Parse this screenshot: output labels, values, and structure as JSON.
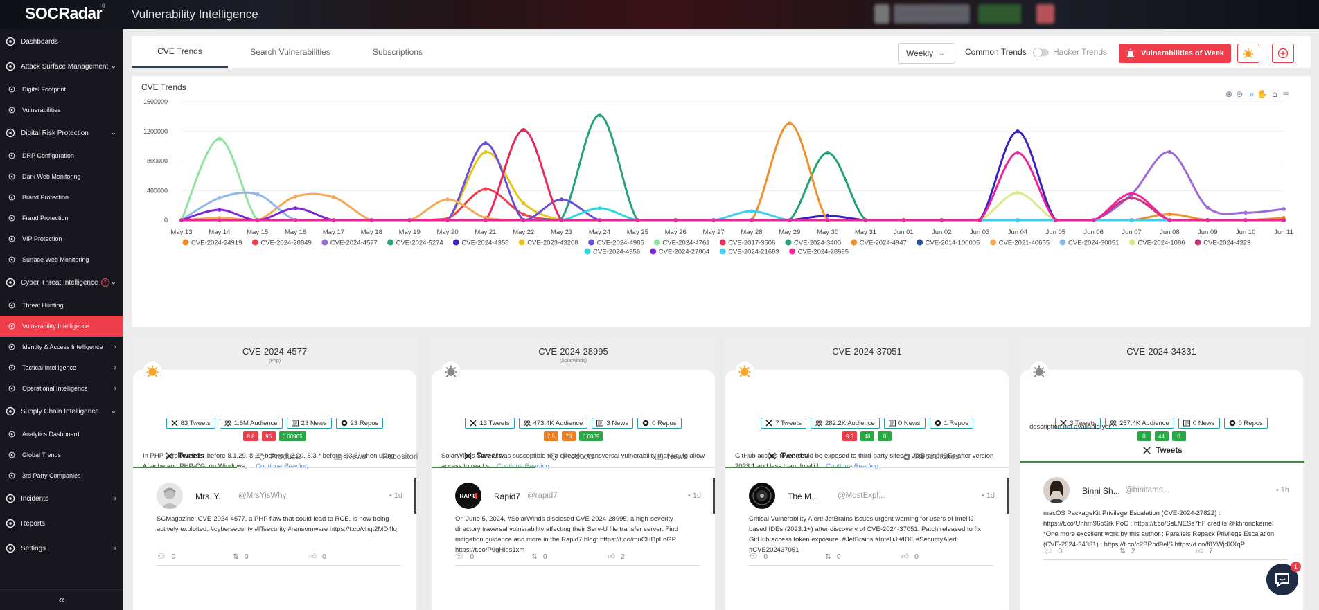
{
  "header": {
    "logo": "SOCRadar",
    "logo_mark": "®",
    "title": "Vulnerability Intelligence"
  },
  "sidebar": {
    "items": [
      {
        "label": "Dashboards",
        "icon": "dashboard-icon",
        "type": "major"
      },
      {
        "label": "Attack Surface Management",
        "icon": "radar-icon",
        "type": "major",
        "chevron": "down"
      },
      {
        "label": "Digital Footprint",
        "icon": "footprint-icon",
        "type": "sub"
      },
      {
        "label": "Vulnerabilities",
        "icon": "vulnerabilities-icon",
        "type": "sub"
      },
      {
        "label": "Digital Risk Protection",
        "icon": "shield-icon",
        "type": "major",
        "chevron": "down"
      },
      {
        "label": "DRP Configuration",
        "icon": "config-icon",
        "type": "sub"
      },
      {
        "label": "Dark Web Monitoring",
        "icon": "dark-web-icon",
        "type": "sub"
      },
      {
        "label": "Brand Protection",
        "icon": "brand-icon",
        "type": "sub"
      },
      {
        "label": "Fraud Protection",
        "icon": "fraud-icon",
        "type": "sub"
      },
      {
        "label": "VIP Protection",
        "icon": "vip-icon",
        "type": "sub"
      },
      {
        "label": "Surface Web Monitoring",
        "icon": "surface-web-icon",
        "type": "sub"
      },
      {
        "label": "Cyber Threat Intelligence",
        "icon": "intel-icon",
        "type": "major",
        "chevron": "down",
        "help": "?"
      },
      {
        "label": "Threat Hunting",
        "icon": "hunting-icon",
        "type": "sub"
      },
      {
        "label": "Vulnerability Intelligence",
        "icon": "bug-icon",
        "type": "sub",
        "active": true
      },
      {
        "label": "Identity & Access Intelligence",
        "icon": "identity-icon",
        "type": "sub",
        "chevron": "right"
      },
      {
        "label": "Tactical Intelligence",
        "icon": "tactical-icon",
        "type": "sub",
        "chevron": "right"
      },
      {
        "label": "Operational Intelligence",
        "icon": "operational-icon",
        "type": "sub",
        "chevron": "right"
      },
      {
        "label": "Supply Chain Intelligence",
        "icon": "supply-chain-icon",
        "type": "major",
        "chevron": "down"
      },
      {
        "label": "Analytics Dashboard",
        "icon": "analytics-icon",
        "type": "sub"
      },
      {
        "label": "Global Trends",
        "icon": "global-icon",
        "type": "sub"
      },
      {
        "label": "3rd Party Companies",
        "icon": "companies-icon",
        "type": "sub"
      },
      {
        "label": "Incidents",
        "icon": "incidents-icon",
        "type": "major",
        "chevron": "right"
      },
      {
        "label": "Reports",
        "icon": "reports-icon",
        "type": "major"
      },
      {
        "label": "Settings",
        "icon": "gear-icon",
        "type": "major",
        "chevron": "right"
      }
    ],
    "collapse": "«"
  },
  "tabs": [
    {
      "label": "CVE Trends",
      "active": true
    },
    {
      "label": "Search Vulnerabilities",
      "active": false
    },
    {
      "label": "Subscriptions",
      "active": false
    }
  ],
  "toolbar": {
    "period": "Weekly",
    "common_trends": "Common Trends",
    "hacker_trends": "Hacker Trends",
    "vuln_week": "Vulnerabilities of Week"
  },
  "chart_card": {
    "title": "CVE Trends"
  },
  "chart_data": {
    "type": "line",
    "title": "CVE Trends",
    "x": [
      "May 13",
      "May 14",
      "May 15",
      "May 16",
      "May 17",
      "May 18",
      "May 19",
      "May 20",
      "May 21",
      "May 22",
      "May 23",
      "May 24",
      "May 25",
      "May 26",
      "May 27",
      "May 28",
      "May 29",
      "May 30",
      "May 31",
      "Jun 01",
      "Jun 02",
      "Jun 03",
      "Jun 04",
      "Jun 05",
      "Jun 06",
      "Jun 07",
      "Jun 08",
      "Jun 09",
      "Jun 10",
      "Jun 11"
    ],
    "y_ticks": [
      0,
      400000,
      800000,
      1200000,
      1600000
    ],
    "ylim": [
      0,
      1600000
    ],
    "legend": "bottom",
    "grid": true,
    "series": [
      {
        "name": "CVE-2024-24919",
        "color": "#f28c28",
        "values": [
          0,
          0,
          0,
          0,
          0,
          0,
          0,
          0,
          0,
          0,
          0,
          0,
          0,
          0,
          0,
          0,
          0,
          0,
          0,
          0,
          0,
          0,
          0,
          0,
          0,
          0,
          80000,
          0,
          0,
          30000
        ]
      },
      {
        "name": "CVE-2024-28849",
        "color": "#ef3e4a",
        "values": [
          0,
          0,
          0,
          0,
          0,
          0,
          0,
          20000,
          420000,
          80000,
          0,
          0,
          0,
          0,
          0,
          0,
          0,
          0,
          0,
          0,
          0,
          0,
          0,
          0,
          0,
          0,
          0,
          0,
          0,
          0
        ]
      },
      {
        "name": "CVE-2024-4577",
        "color": "#9b6ad9",
        "values": [
          0,
          0,
          0,
          0,
          0,
          0,
          0,
          0,
          0,
          0,
          0,
          0,
          0,
          0,
          0,
          0,
          0,
          0,
          0,
          0,
          0,
          0,
          0,
          0,
          0,
          350000,
          920000,
          170000,
          100000,
          150000
        ]
      },
      {
        "name": "CVE-2024-5274",
        "color": "#26a17b",
        "values": [
          0,
          0,
          0,
          0,
          0,
          0,
          0,
          0,
          0,
          0,
          20000,
          1420000,
          0,
          0,
          0,
          0,
          0,
          0,
          0,
          0,
          0,
          0,
          0,
          0,
          0,
          0,
          0,
          0,
          0,
          0
        ]
      },
      {
        "name": "CVE-2024-4358",
        "color": "#3b1fbf",
        "values": [
          0,
          0,
          0,
          0,
          0,
          0,
          0,
          0,
          0,
          0,
          0,
          0,
          0,
          0,
          0,
          0,
          0,
          60000,
          0,
          0,
          0,
          0,
          1200000,
          0,
          0,
          0,
          0,
          0,
          0,
          0
        ]
      },
      {
        "name": "CVE-2023-43208",
        "color": "#e6c619",
        "values": [
          0,
          0,
          0,
          0,
          0,
          0,
          0,
          0,
          920000,
          230000,
          0,
          0,
          0,
          0,
          0,
          0,
          0,
          0,
          0,
          0,
          0,
          0,
          0,
          0,
          0,
          0,
          0,
          0,
          0,
          0
        ]
      },
      {
        "name": "CVE-2024-4985",
        "color": "#6a4fd8",
        "values": [
          0,
          0,
          0,
          0,
          0,
          0,
          0,
          0,
          1040000,
          0,
          280000,
          0,
          0,
          0,
          0,
          0,
          0,
          0,
          0,
          0,
          0,
          0,
          0,
          0,
          0,
          0,
          0,
          0,
          0,
          0
        ]
      },
      {
        "name": "CVE-2024-4761",
        "color": "#8fe3a3",
        "values": [
          0,
          1100000,
          0,
          0,
          0,
          0,
          0,
          0,
          0,
          0,
          0,
          0,
          0,
          0,
          0,
          0,
          0,
          0,
          0,
          0,
          0,
          0,
          0,
          0,
          0,
          0,
          0,
          0,
          0,
          0
        ]
      },
      {
        "name": "CVE-2017-3506",
        "color": "#e8285a",
        "values": [
          0,
          0,
          0,
          0,
          0,
          0,
          0,
          0,
          0,
          1220000,
          0,
          0,
          0,
          0,
          0,
          0,
          0,
          0,
          0,
          0,
          0,
          0,
          0,
          0,
          0,
          0,
          0,
          0,
          0,
          0
        ]
      },
      {
        "name": "CVE-2024-3400",
        "color": "#1fa36e",
        "values": [
          0,
          0,
          0,
          0,
          0,
          0,
          0,
          0,
          0,
          0,
          0,
          0,
          0,
          0,
          0,
          0,
          0,
          910000,
          0,
          0,
          0,
          0,
          0,
          0,
          0,
          0,
          0,
          0,
          0,
          0
        ]
      },
      {
        "name": "CVE-2024-4947",
        "color": "#f0902a",
        "values": [
          0,
          0,
          0,
          0,
          0,
          0,
          0,
          0,
          0,
          0,
          0,
          0,
          0,
          0,
          0,
          0,
          1310000,
          0,
          0,
          0,
          0,
          0,
          0,
          0,
          0,
          0,
          0,
          0,
          0,
          0
        ]
      },
      {
        "name": "CVE-2014-100005",
        "color": "#1e4fa3",
        "values": [
          0,
          0,
          0,
          0,
          0,
          0,
          0,
          0,
          0,
          0,
          0,
          0,
          0,
          0,
          0,
          0,
          0,
          0,
          0,
          0,
          0,
          0,
          0,
          0,
          0,
          0,
          0,
          0,
          0,
          0
        ]
      },
      {
        "name": "CVE-2021-40655",
        "color": "#f5a855",
        "values": [
          0,
          30000,
          0,
          320000,
          310000,
          0,
          0,
          280000,
          30000,
          0,
          0,
          0,
          0,
          0,
          0,
          0,
          0,
          0,
          0,
          0,
          0,
          0,
          0,
          0,
          0,
          0,
          0,
          0,
          0,
          0
        ]
      },
      {
        "name": "CVE-2024-30051",
        "color": "#8fb8e8",
        "values": [
          0,
          300000,
          350000,
          0,
          0,
          0,
          0,
          0,
          0,
          0,
          0,
          0,
          0,
          0,
          0,
          0,
          0,
          0,
          0,
          0,
          0,
          0,
          0,
          0,
          0,
          0,
          0,
          0,
          0,
          0
        ]
      },
      {
        "name": "CVE-2024-1086",
        "color": "#dfe889",
        "values": [
          0,
          0,
          0,
          0,
          0,
          0,
          0,
          0,
          0,
          0,
          0,
          0,
          0,
          0,
          0,
          0,
          0,
          0,
          0,
          0,
          0,
          0,
          370000,
          0,
          0,
          0,
          0,
          0,
          0,
          0
        ]
      },
      {
        "name": "CVE-2024-4323",
        "color": "#c8347a",
        "values": [
          0,
          0,
          0,
          0,
          0,
          0,
          0,
          0,
          0,
          0,
          0,
          0,
          0,
          0,
          0,
          0,
          0,
          0,
          0,
          0,
          0,
          0,
          0,
          0,
          0,
          300000,
          0,
          0,
          0,
          0
        ]
      },
      {
        "name": "CVE-2024-4956",
        "color": "#2fd6e0",
        "values": [
          0,
          0,
          0,
          0,
          0,
          0,
          0,
          0,
          0,
          0,
          0,
          160000,
          0,
          0,
          0,
          0,
          0,
          0,
          0,
          0,
          0,
          0,
          0,
          0,
          0,
          0,
          0,
          0,
          0,
          0
        ]
      },
      {
        "name": "CVE-2024-27804",
        "color": "#7c2ad6",
        "values": [
          0,
          140000,
          0,
          160000,
          0,
          0,
          0,
          0,
          0,
          0,
          0,
          0,
          0,
          0,
          0,
          0,
          0,
          0,
          0,
          0,
          0,
          0,
          0,
          0,
          0,
          0,
          0,
          0,
          0,
          0
        ]
      },
      {
        "name": "CVE-2024-21683",
        "color": "#3fd0f0",
        "values": [
          0,
          0,
          0,
          0,
          0,
          0,
          0,
          0,
          0,
          0,
          0,
          0,
          0,
          0,
          0,
          120000,
          0,
          0,
          0,
          0,
          0,
          0,
          0,
          0,
          0,
          0,
          0,
          0,
          0,
          0
        ]
      },
      {
        "name": "CVE-2024-28995",
        "color": "#f0249a",
        "values": [
          0,
          0,
          0,
          0,
          0,
          0,
          0,
          0,
          0,
          0,
          0,
          0,
          0,
          0,
          0,
          0,
          0,
          0,
          0,
          0,
          0,
          0,
          910000,
          0,
          0,
          360000,
          0,
          0,
          0,
          0
        ]
      }
    ]
  },
  "cards": [
    {
      "cve": "CVE-2024-4577",
      "vendor": "(Php)",
      "bug_color": "#f5a623",
      "stats": [
        "83 Tweets",
        "1.6M Audience",
        "23 News",
        "23 Repos"
      ],
      "scores": [
        {
          "v": "9.8",
          "c": "#ef3e4a"
        },
        {
          "v": "96",
          "c": "#ef3e4a"
        },
        {
          "v": "0.00965",
          "c": "#28a745"
        }
      ],
      "desc": "In PHP versions 8.1.* before 8.1.29, 8.2.* before 8.2.20, 8.3.* before 8.3.8, when using Apache and PHP-CGI on Windows, ...",
      "more": "Continue Reading",
      "tabs": [
        "Tweets",
        "Products",
        "News",
        "Repositories"
      ],
      "tweet": {
        "name": "Mrs. Y.",
        "handle": "@MrsYisWhy",
        "time": "• 1d",
        "text": "SCMagazine: CVE-2024-4577, a PHP flaw that could lead to RCE, is now being actively exploited. #cybersecurity #ITsecurity #ransomware https://t.co/vhqt2MD4lq",
        "replies": "0",
        "retweets": "0",
        "likes": "0"
      }
    },
    {
      "cve": "CVE-2024-28995",
      "vendor": "(Solarwinds)",
      "bug_color": "#888888",
      "stats": [
        "13 Tweets",
        "473.4K Audience",
        "3 News",
        "0 Repos"
      ],
      "scores": [
        {
          "v": "7.5",
          "c": "#f07f22"
        },
        {
          "v": "73",
          "c": "#f07f22"
        },
        {
          "v": "0.0009",
          "c": "#28a745"
        }
      ],
      "desc": "SolarWinds Serv-U was susceptible to a directory transversal vulnerability that would allow access to read s...",
      "more": "Continue Reading",
      "tabs": [
        "Tweets",
        "Products",
        "News"
      ],
      "tweet": {
        "name": "Rapid7",
        "handle": "@rapid7",
        "time": "• 1d",
        "text": "On June 5, 2024, #SolarWinds disclosed CVE-2024-28995, a high-severity directory traversal vulnerability affecting their Serv-U file transfer server. Find mitigation guidance and more in the Rapid7 blog: https://t.co/muCHDpLnGP https://t.co/P9gHlqs1xm",
        "replies": "0",
        "retweets": "0",
        "likes": "2"
      }
    },
    {
      "cve": "CVE-2024-37051",
      "vendor": "",
      "bug_color": "#f5a623",
      "stats": [
        "7 Tweets",
        "282.2K Audience",
        "0 News",
        "1 Repos"
      ],
      "scores": [
        {
          "v": "9.3",
          "c": "#ef3e4a"
        },
        {
          "v": "48",
          "c": "#28a745"
        },
        {
          "v": "0",
          "c": "#28a745"
        }
      ],
      "desc": "GitHub access token could be exposed to third-party sites in JetBrains IDEs after version 2023.1 and less than: IntelliJ...",
      "more": "Continue Reading",
      "tabs": [
        "Tweets",
        "Repositories"
      ],
      "tweet": {
        "name": "The M...",
        "handle": "@MostExpl...",
        "time": "• 1d",
        "text": "Critical Vulnerability Alert! JetBrains issues urgent warning for users of IntelliJ-based IDEs (2023.1+) after discovery of CVE-2024-37051. Patch released to fix GitHub access token exposure. #JetBrains #IntelliJ #IDE #SecurityAlert #CVE202437051",
        "replies": "0",
        "retweets": "0",
        "likes": "0"
      }
    },
    {
      "cve": "CVE-2024-34331",
      "vendor": "",
      "bug_color": "#888888",
      "stats": [
        "3 Tweets",
        "257.4K Audience",
        "0 News",
        "0 Repos"
      ],
      "scores": [
        {
          "v": "0",
          "c": "#28a745"
        },
        {
          "v": "44",
          "c": "#28a745"
        },
        {
          "v": "0",
          "c": "#28a745"
        }
      ],
      "desc": "description not avaliable yet",
      "more": "",
      "tabs": [
        "Tweets"
      ],
      "tweet": {
        "name": "Binni Sh...",
        "handle": "@binitams...",
        "time": "• 1h",
        "text": "macOS PackageKit Privilege Escalation (CVE-2024-27822) : https://t.co/Uhhm96oSrk PoC : https://t.co/SsLNESs7hF credits @khronokernel *One more excellent work by this author : Parallels Repack Privilege Escalation (CVE-2024-34331) : https://t.co/c2BRbd9elS https://t.co/f8YWjdXXqP",
        "replies": "0",
        "retweets": "2",
        "likes": "7"
      }
    }
  ],
  "chat": {
    "badge": "1"
  }
}
